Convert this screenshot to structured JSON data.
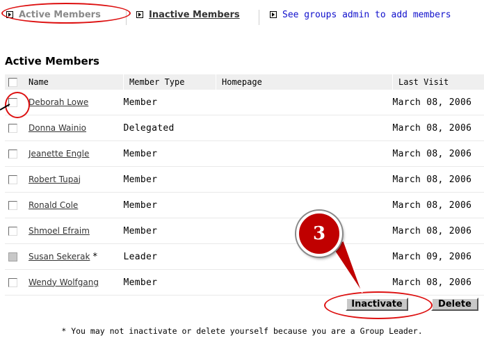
{
  "nav": {
    "active_members": "Active Members",
    "inactive_members": "Inactive Members",
    "see_groups_admin": "See groups admin to add members"
  },
  "section_title": "Active Members",
  "table": {
    "headers": {
      "name": "Name",
      "member_type": "Member Type",
      "homepage": "Homepage",
      "last_visit": "Last Visit"
    },
    "rows": [
      {
        "name": "Deborah Lowe",
        "member_type": "Member",
        "homepage": "",
        "last_visit": "March 08, 2006",
        "leader_mark": ""
      },
      {
        "name": "Donna Wainio",
        "member_type": "Delegated",
        "homepage": "",
        "last_visit": "March 08, 2006",
        "leader_mark": ""
      },
      {
        "name": "Jeanette Engle",
        "member_type": "Member",
        "homepage": "",
        "last_visit": "March 08, 2006",
        "leader_mark": ""
      },
      {
        "name": "Robert Tupaj",
        "member_type": "Member",
        "homepage": "",
        "last_visit": "March 08, 2006",
        "leader_mark": ""
      },
      {
        "name": "Ronald Cole",
        "member_type": "Member",
        "homepage": "",
        "last_visit": "March 08, 2006",
        "leader_mark": ""
      },
      {
        "name": "Shmoel Efraim",
        "member_type": "Member",
        "homepage": "",
        "last_visit": "March 08, 2006",
        "leader_mark": ""
      },
      {
        "name": "Susan Sekerak",
        "member_type": "Leader",
        "homepage": "",
        "last_visit": "March 09, 2006",
        "leader_mark": "*"
      },
      {
        "name": "Wendy Wolfgang",
        "member_type": "Member",
        "homepage": "",
        "last_visit": "March 08, 2006",
        "leader_mark": ""
      }
    ]
  },
  "buttons": {
    "inactivate": "Inactivate",
    "delete": "Delete"
  },
  "footnote": "* You may not inactivate or delete yourself because you are a Group Leader.",
  "annotation": {
    "step_number": "3",
    "highlight_color": "#dd1010",
    "badge_color": "#c00000"
  },
  "icons": {
    "nav_bullet": "arrow-bullet-icon",
    "checkbox": "checkbox-icon"
  }
}
